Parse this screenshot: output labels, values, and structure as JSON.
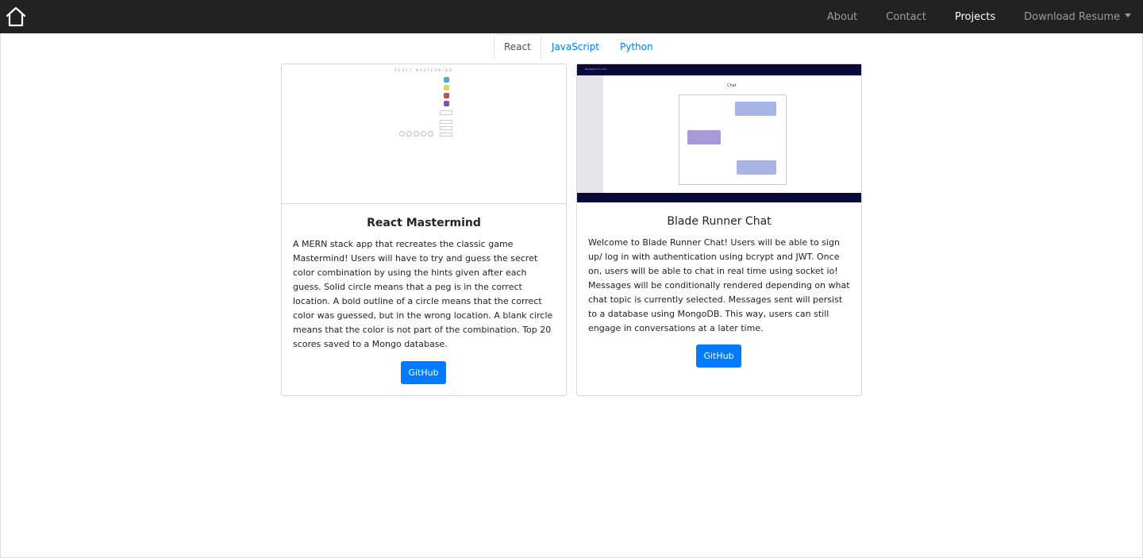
{
  "navbar": {
    "links": [
      {
        "label": "About"
      },
      {
        "label": "Contact"
      },
      {
        "label": "Projects"
      },
      {
        "label": "Download Resume"
      }
    ]
  },
  "tabs": [
    {
      "label": "React"
    },
    {
      "label": "JavaScript"
    },
    {
      "label": "Python"
    }
  ],
  "cards": [
    {
      "title": "React Mastermind",
      "description": "A MERN stack app that recreates the classic game Mastermind! Users will have to try and guess the secret color combination by using the hints given after each guess. Solid circle means that a peg is in the correct location. A bold outline of a circle means that the correct color was guessed, but in the wrong location. A blank circle means that the color is not part of the combination. Top 20 scores saved to a Mongo database.",
      "button_label": "GitHub",
      "thumbnail": {
        "title": "REACT MASTERMIND",
        "peg_colors": [
          "#4aa8d8",
          "#e8d24a",
          "#d04848",
          "#8a4ab0"
        ]
      }
    },
    {
      "title": "Blade Runner Chat",
      "description": "Welcome to Blade Runner Chat! Users will be able to sign up/ log in with authentication using bcrypt and JWT. Once on, users will be able to chat in real time using socket io! Messages will be conditionally rendered depending on what chat topic is currently selected. Messages sent will persist to a database using MongoDB. This way, users can still engage in conversations at a later time.",
      "button_label": "GitHub",
      "thumbnail": {
        "app_title": "BladeRunner Chat",
        "heading": "Chat",
        "topbar_color": "#0a0a3a"
      }
    }
  ],
  "colors": {
    "navbar": "#222222",
    "accent": "#007bff"
  }
}
